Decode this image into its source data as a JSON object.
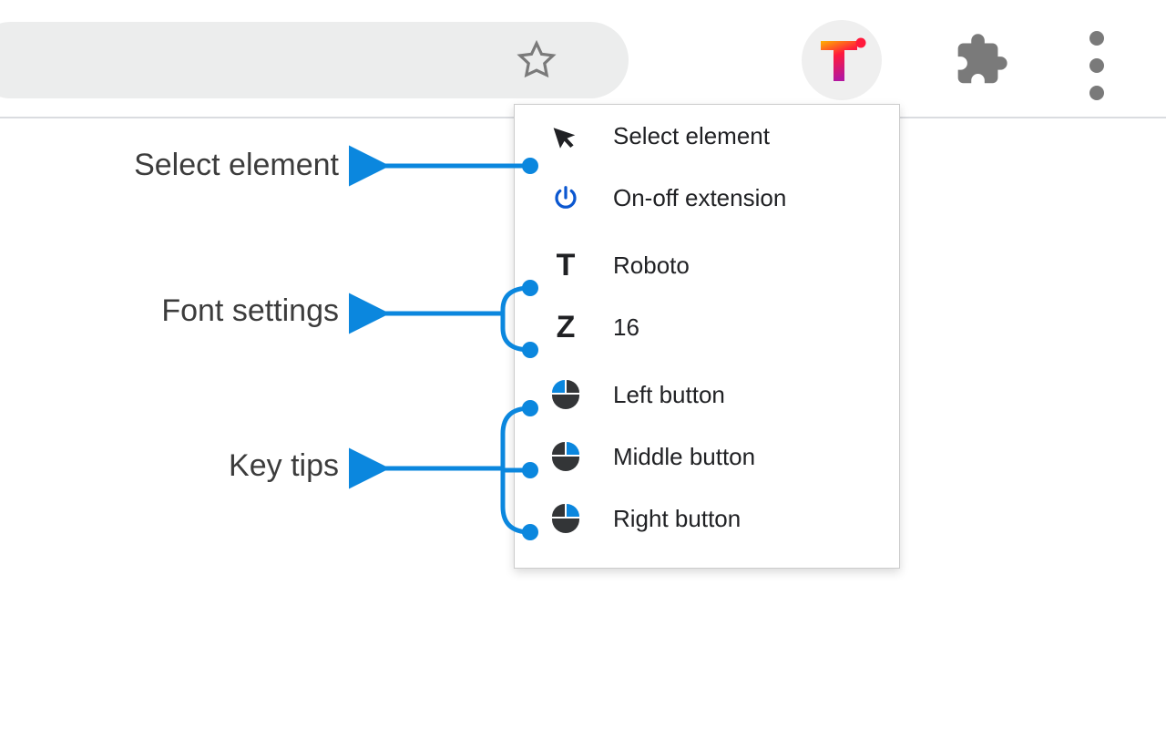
{
  "annotations": {
    "select_element": "Select element",
    "font_settings": "Font settings",
    "key_tips": "Key tips"
  },
  "popup": {
    "items": [
      {
        "label": "Select element"
      },
      {
        "label": "On-off extension"
      },
      {
        "label": "Roboto"
      },
      {
        "label": "16"
      },
      {
        "label": "Left button"
      },
      {
        "label": "Middle button"
      },
      {
        "label": "Right button"
      }
    ]
  },
  "colors": {
    "accent": "#0b87de",
    "text": "#202124"
  }
}
